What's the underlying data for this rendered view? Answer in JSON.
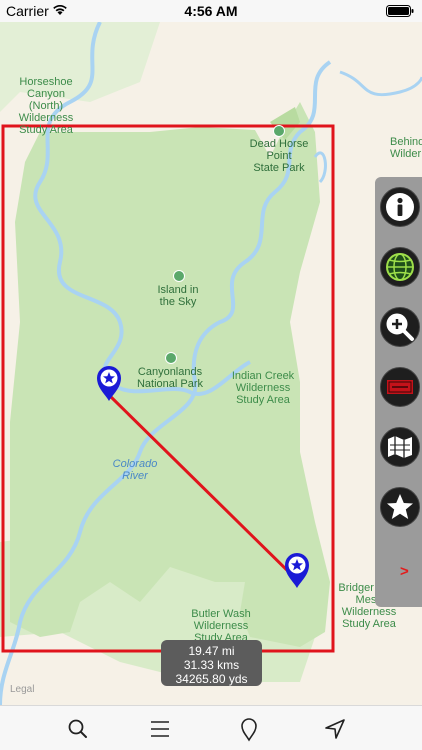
{
  "status": {
    "carrier": "Carrier",
    "time": "4:56 AM"
  },
  "map": {
    "labels": {
      "horseshoe_canyon": [
        "Horseshoe Canyon",
        "(North) Wilderness",
        "Study Area"
      ],
      "dead_horse_point": [
        "Dead Horse",
        "Point",
        "State Park"
      ],
      "behind_rocks": [
        "Behind",
        "Wilder"
      ],
      "island_in_the_sky": [
        "Island in",
        "the Sky"
      ],
      "canyonlands": [
        "Canyonlands",
        "National Park"
      ],
      "indian_creek": [
        "Indian Creek",
        "Wilderness",
        "Study Area"
      ],
      "colorado_river": [
        "Colorado",
        "River"
      ],
      "bridger_jack": [
        "Bridger Jack",
        "Mesa Wilderness",
        "Study Area"
      ],
      "butler_wash": [
        "Butler Wash",
        "Wilderness",
        "Study Area"
      ]
    },
    "legal": "Legal",
    "colors": {
      "park_green": "#cbe6b8",
      "water": "#a9d3f2",
      "boundary": "#e0141c",
      "route": "#e0141c",
      "pin": "#1a1ad6"
    }
  },
  "distance": {
    "miles": "19.47 mi",
    "kms": "31.33 kms",
    "yards": "34265.80 yds"
  },
  "side_panel": {
    "buttons": [
      "info-icon",
      "globe-icon",
      "zoom-in-icon",
      "label-icon",
      "map-icon",
      "star-icon"
    ],
    "arrow": ">"
  },
  "toolbar": {
    "icons": [
      "search-icon",
      "menu-icon",
      "pin-icon",
      "location-arrow-icon"
    ]
  }
}
